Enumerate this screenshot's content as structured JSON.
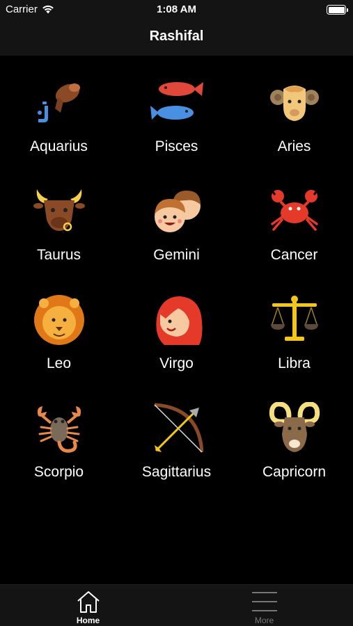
{
  "status": {
    "carrier": "Carrier",
    "time": "1:08 AM"
  },
  "nav": {
    "title": "Rashifal"
  },
  "signs": [
    {
      "name": "Aquarius",
      "icon": "aquarius-icon"
    },
    {
      "name": "Pisces",
      "icon": "pisces-icon"
    },
    {
      "name": "Aries",
      "icon": "aries-icon"
    },
    {
      "name": "Taurus",
      "icon": "taurus-icon"
    },
    {
      "name": "Gemini",
      "icon": "gemini-icon"
    },
    {
      "name": "Cancer",
      "icon": "cancer-icon"
    },
    {
      "name": "Leo",
      "icon": "leo-icon"
    },
    {
      "name": "Virgo",
      "icon": "virgo-icon"
    },
    {
      "name": "Libra",
      "icon": "libra-icon"
    },
    {
      "name": "Scorpio",
      "icon": "scorpio-icon"
    },
    {
      "name": "Sagittarius",
      "icon": "sagittarius-icon"
    },
    {
      "name": "Capricorn",
      "icon": "capricorn-icon"
    }
  ],
  "tabs": [
    {
      "label": "Home",
      "icon": "home-icon",
      "active": true
    },
    {
      "label": "More",
      "icon": "menu-icon",
      "active": false
    }
  ],
  "colors": {
    "background": "#000000",
    "bar": "#141414",
    "active_tab": "#ffffff",
    "inactive_tab": "#777777"
  }
}
